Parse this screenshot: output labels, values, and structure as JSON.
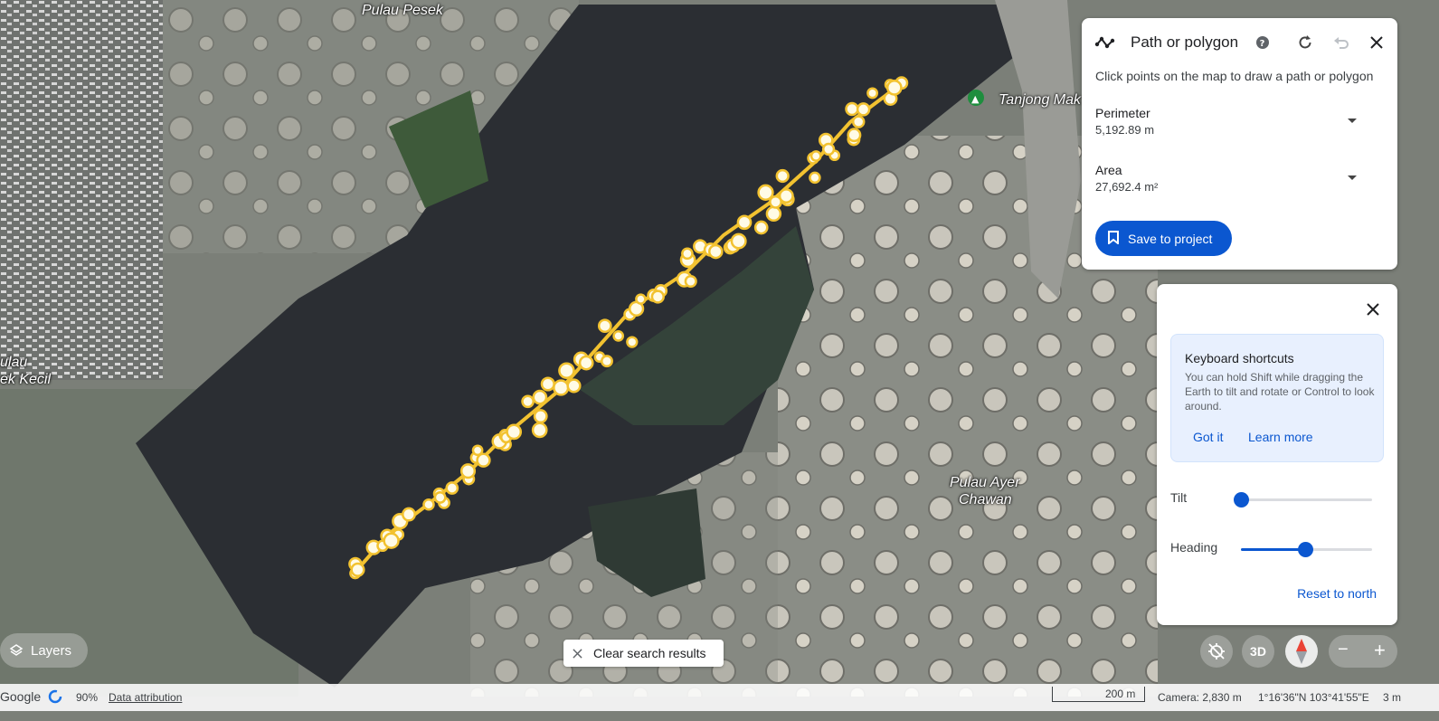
{
  "map_labels": {
    "pulau_pesek": "Pulau Pesek",
    "tanjong": "Tanjong Mak",
    "pulau_kecil_1": "ulau",
    "pulau_kecil_2": "ek Kecil",
    "ayer_chawan_1": "Pulau Ayer",
    "ayer_chawan_2": "Chawan"
  },
  "path_panel": {
    "title": "Path or polygon",
    "instruction": "Click points on the map to draw a path or polygon",
    "perimeter_label": "Perimeter",
    "perimeter_value": "5,192.89 m",
    "area_label": "Area",
    "area_value": "27,692.4 m²",
    "save_label": "Save to project"
  },
  "nav_panel": {
    "tips_title": "Keyboard shortcuts",
    "tips_body": "You can hold Shift while dragging the Earth to tilt and rotate or Control to look around.",
    "got_it": "Got it",
    "learn_more": "Learn more",
    "tilt_label": "Tilt",
    "tilt_value": 0,
    "heading_label": "Heading",
    "heading_value": 0.49,
    "reset_north": "Reset to north"
  },
  "controls": {
    "layers_label": "Layers",
    "clear_label": "Clear search results",
    "three_d_label": "3D",
    "zoom_out": "−",
    "zoom_in": "+"
  },
  "status_bar": {
    "google": "Google",
    "progress": "90%",
    "attribution": "Data attribution",
    "scale": "200 m",
    "camera": "Camera: 2,830 m",
    "coords": "1°16'36\"N 103°41'55\"E",
    "elevation": "3 m"
  },
  "colors": {
    "accent": "#0b57d0",
    "path": "#f2c230",
    "water": "#2b2e33"
  }
}
